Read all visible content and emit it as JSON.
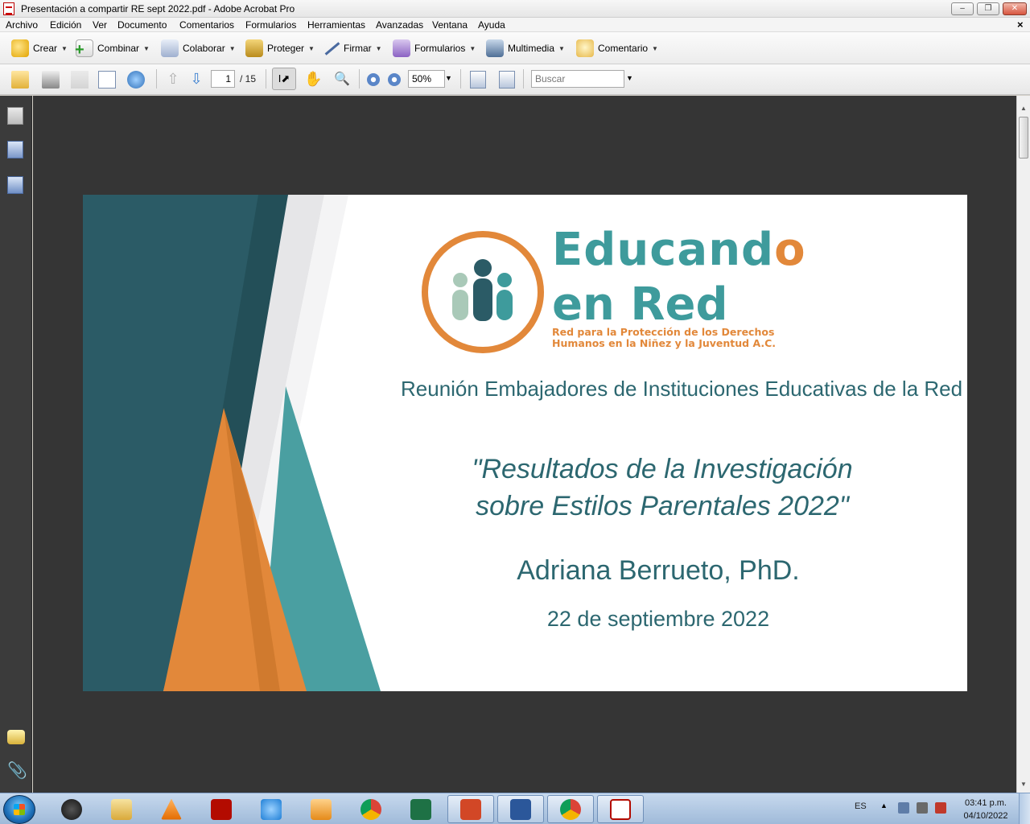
{
  "window": {
    "title": "Presentación a compartir RE sept 2022.pdf - Adobe Acrobat Pro",
    "minimize": "–",
    "maximize": "❐",
    "close": "✕"
  },
  "menubar": {
    "items": [
      "Archivo",
      "Edición",
      "Ver",
      "Documento",
      "Comentarios",
      "Formularios",
      "Herramientas",
      "Avanzadas",
      "Ventana",
      "Ayuda"
    ],
    "close_doc": "×"
  },
  "toolbar": {
    "tasks": [
      {
        "label": "Crear",
        "icon": "create-pdf-icon"
      },
      {
        "label": "Combinar",
        "icon": "combine-icon"
      },
      {
        "label": "Colaborar",
        "icon": "collaborate-icon"
      },
      {
        "label": "Proteger",
        "icon": "lock-icon"
      },
      {
        "label": "Firmar",
        "icon": "pen-icon"
      },
      {
        "label": "Formularios",
        "icon": "form-icon"
      },
      {
        "label": "Multimedia",
        "icon": "multimedia-icon"
      },
      {
        "label": "Comentario",
        "icon": "comment-icon"
      }
    ]
  },
  "navigation": {
    "page_current": "1",
    "page_total": "/ 15",
    "zoom": "50%",
    "search_placeholder": "Buscar"
  },
  "slide": {
    "logo_line1_main": "Educand",
    "logo_line1_accent": "o",
    "logo_line2": "en Red",
    "logo_sub_1": "Red para la Protección de los Derechos",
    "logo_sub_2": "Humanos en la Niñez y la Juventud A.C.",
    "meeting_title": "Reunión Embajadores de Instituciones Educativas de la Red",
    "talk_title_1": "\"Resultados de la Investigación",
    "talk_title_2": "sobre Estilos Parentales 2022\"",
    "speaker": "Adriana Berrueto, PhD.",
    "date": "22 de septiembre 2022"
  },
  "colors": {
    "teal_dark": "#2c6770",
    "teal": "#3e9b9c",
    "orange": "#e2883a",
    "doc_background": "#353535"
  },
  "taskbar": {
    "apps": [
      "Audio app",
      "Windows Explorer",
      "VLC",
      "Adobe Reader",
      "Blue app",
      "Media Player",
      "Google Chrome",
      "Excel",
      "PowerPoint",
      "Word",
      "Chrome",
      "Adobe Acrobat"
    ],
    "lang": "ES",
    "time": "03:41 p.m.",
    "date": "04/10/2022"
  }
}
